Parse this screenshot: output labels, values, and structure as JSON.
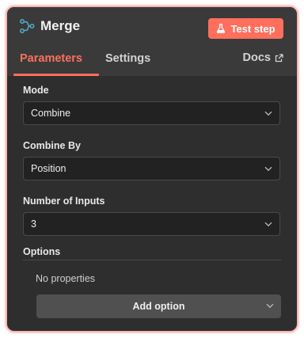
{
  "node": {
    "title": "Merge",
    "icon": "merge-icon",
    "test_button_label": "Test step",
    "test_button_icon": "flask-icon",
    "accent_color": "#ff6f5c"
  },
  "tabs": {
    "parameters": "Parameters",
    "settings": "Settings",
    "docs": "Docs",
    "active": "Parameters"
  },
  "fields": {
    "mode": {
      "label": "Mode",
      "value": "Combine"
    },
    "combine_by": {
      "label": "Combine By",
      "value": "Position"
    },
    "number_of_inputs": {
      "label": "Number of Inputs",
      "value": "3"
    }
  },
  "options": {
    "label": "Options",
    "empty_text": "No properties",
    "add_button_label": "Add option"
  }
}
